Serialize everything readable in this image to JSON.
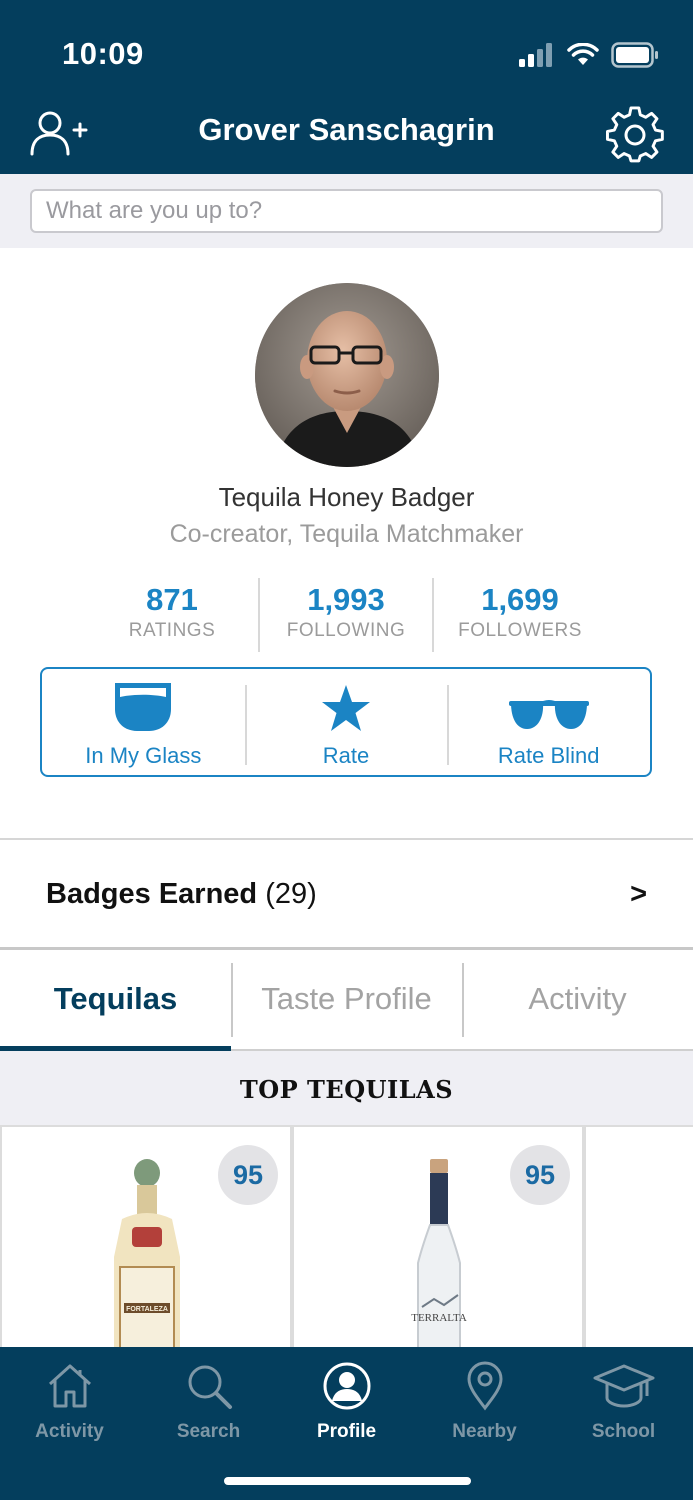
{
  "status": {
    "time": "10:09"
  },
  "header": {
    "title": "Grover Sanschagrin"
  },
  "post": {
    "placeholder": "What are you up to?"
  },
  "profile": {
    "name": "Tequila Honey Badger",
    "subtitle": "Co-creator, Tequila Matchmaker"
  },
  "stats": [
    {
      "value": "871",
      "label": "RATINGS"
    },
    {
      "value": "1,993",
      "label": "FOLLOWING"
    },
    {
      "value": "1,699",
      "label": "FOLLOWERS"
    }
  ],
  "actions": [
    {
      "label": "In My Glass",
      "icon": "glass-icon"
    },
    {
      "label": "Rate",
      "icon": "star-icon"
    },
    {
      "label": "Rate Blind",
      "icon": "sunglasses-icon"
    }
  ],
  "badges": {
    "title": "Badges Earned",
    "count": "(29)",
    "arrow": ">"
  },
  "tabs": [
    "Tequilas",
    "Taste Profile",
    "Activity"
  ],
  "top_section": {
    "title": "TOP TEQUILAS"
  },
  "products": [
    {
      "score": "95",
      "label": "FORTALEZA"
    },
    {
      "score": "95",
      "label": "TERRALTA"
    }
  ],
  "bottom_nav": [
    {
      "label": "Activity",
      "icon": "home-icon"
    },
    {
      "label": "Search",
      "icon": "search-icon"
    },
    {
      "label": "Profile",
      "icon": "profile-icon"
    },
    {
      "label": "Nearby",
      "icon": "location-pin-icon"
    },
    {
      "label": "School",
      "icon": "graduation-cap-icon"
    }
  ],
  "colors": {
    "header_bg": "#043e5d",
    "accent_blue": "#1b84c4",
    "muted_gray": "#9b9b9b",
    "band_bg": "#efeff4"
  }
}
